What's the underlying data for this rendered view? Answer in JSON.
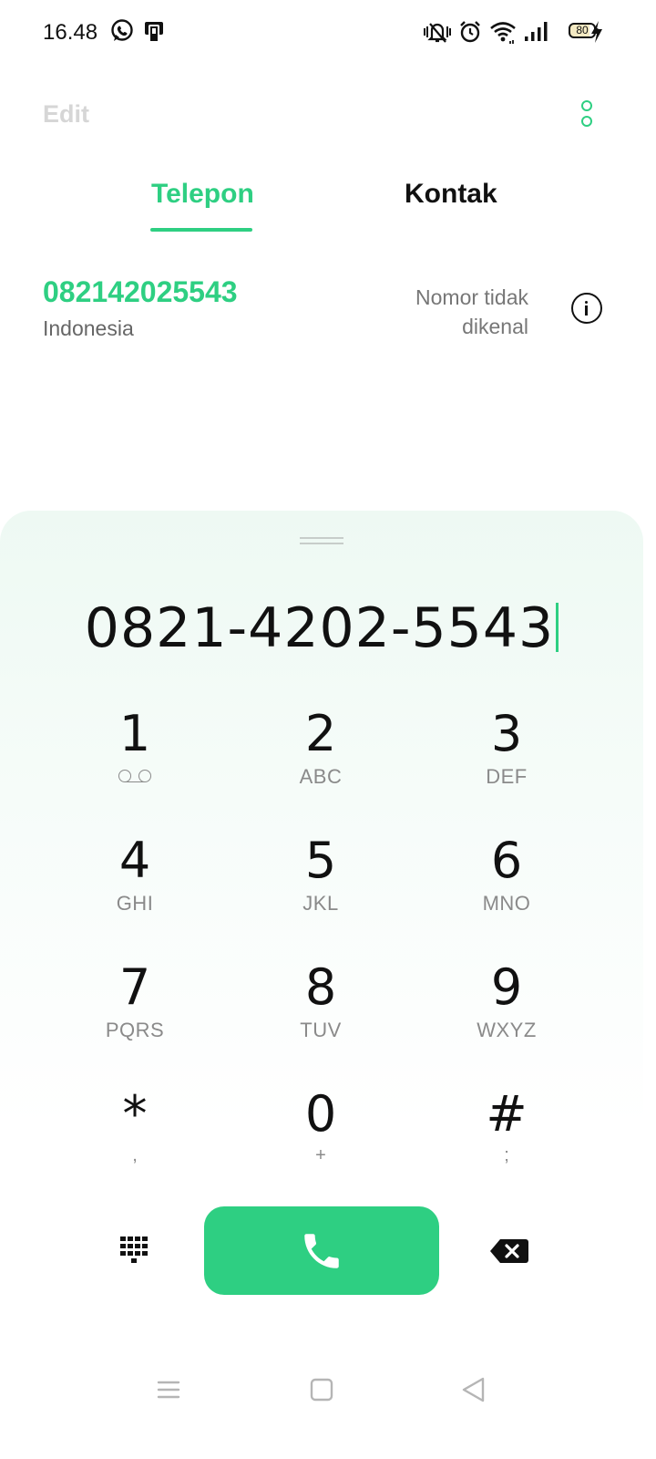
{
  "status_bar": {
    "time": "16.48",
    "battery": "80",
    "icons": [
      "whatsapp-icon",
      "sim-app-icon",
      "vibrate-mute-icon",
      "alarm-icon",
      "wifi-icon",
      "signal-icon",
      "battery-icon",
      "charging-icon"
    ]
  },
  "header": {
    "edit_label": "Edit",
    "more_icon": "more-vertical-icon"
  },
  "tabs": [
    {
      "label": "Telepon",
      "active": true
    },
    {
      "label": "Kontak",
      "active": false
    }
  ],
  "match": {
    "number": "082142025543",
    "country": "Indonesia",
    "status": "Nomor tidak dikenal",
    "info_icon": "info-icon"
  },
  "dialer": {
    "input": "0821-4202-5543",
    "keys": [
      {
        "digit": "1",
        "sub": ""
      },
      {
        "digit": "2",
        "sub": "ABC"
      },
      {
        "digit": "3",
        "sub": "DEF"
      },
      {
        "digit": "4",
        "sub": "GHI"
      },
      {
        "digit": "5",
        "sub": "JKL"
      },
      {
        "digit": "6",
        "sub": "MNO"
      },
      {
        "digit": "7",
        "sub": "PQRS"
      },
      {
        "digit": "8",
        "sub": "TUV"
      },
      {
        "digit": "9",
        "sub": "WXYZ"
      },
      {
        "digit": "*",
        "sub": ","
      },
      {
        "digit": "0",
        "sub": "+"
      },
      {
        "digit": "#",
        "sub": ";"
      }
    ]
  },
  "colors": {
    "accent": "#2ecf82",
    "text_primary": "#111111",
    "text_secondary": "#8a8a8a",
    "disabled": "#d6d6d6"
  },
  "nav": {
    "icons": [
      "menu-icon",
      "home-icon",
      "back-icon"
    ]
  }
}
